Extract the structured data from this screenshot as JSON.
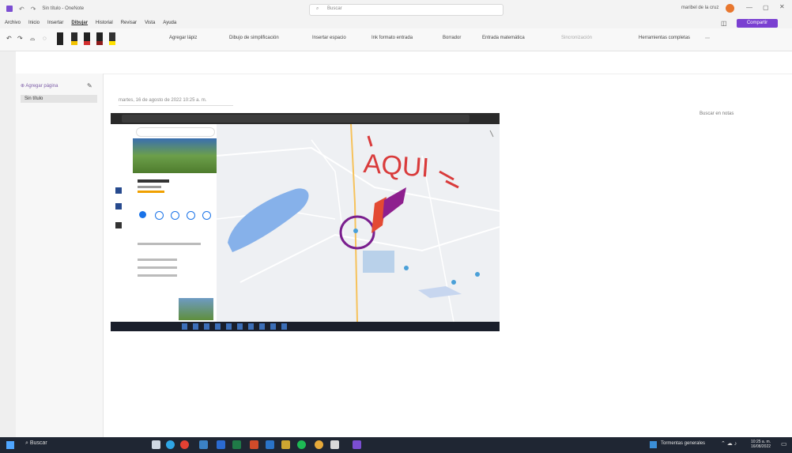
{
  "window": {
    "title": "Sin título - OneNote",
    "search_placeholder": "Buscar",
    "user_name": "maribel de la cruz",
    "share_label": "Compartir"
  },
  "menu": [
    "Archivo",
    "Inicio",
    "Insertar",
    "Dibujar",
    "Historial",
    "Revisar",
    "Vista",
    "Ayuda"
  ],
  "menu_active": "Dibujar",
  "ribbon": {
    "add_pen": "Agregar lápiz",
    "ruler": "Dibujo de simplificación",
    "insert_space": "Insertar espacio",
    "shapes": "Ink formato entrada",
    "ink_to_text": "Borrador",
    "math": "Entrada matemática",
    "view_pages": "Sincronización",
    "full_pages": "Herramientas completas"
  },
  "search_right": "Buscar en notas",
  "left_panel": {
    "add_page": "Agregar página",
    "page_item": "Sin título"
  },
  "page_meta": "martes, 16 de agosto de 2022   10:25 a. m.",
  "map_annotation": "AQUI",
  "taskbar": {
    "search_label": "Buscar",
    "weather": "Tormentas generales",
    "time": "10:25 a. m.",
    "date": "16/08/2022"
  },
  "colors": {
    "accent": "#7b4ed2",
    "share_btn": "#7a3fd1",
    "avatar": "#e8772e",
    "annotation_red": "#d93b3b",
    "annotation_purple": "#7a1f8e",
    "lake": "#86b1ea"
  }
}
